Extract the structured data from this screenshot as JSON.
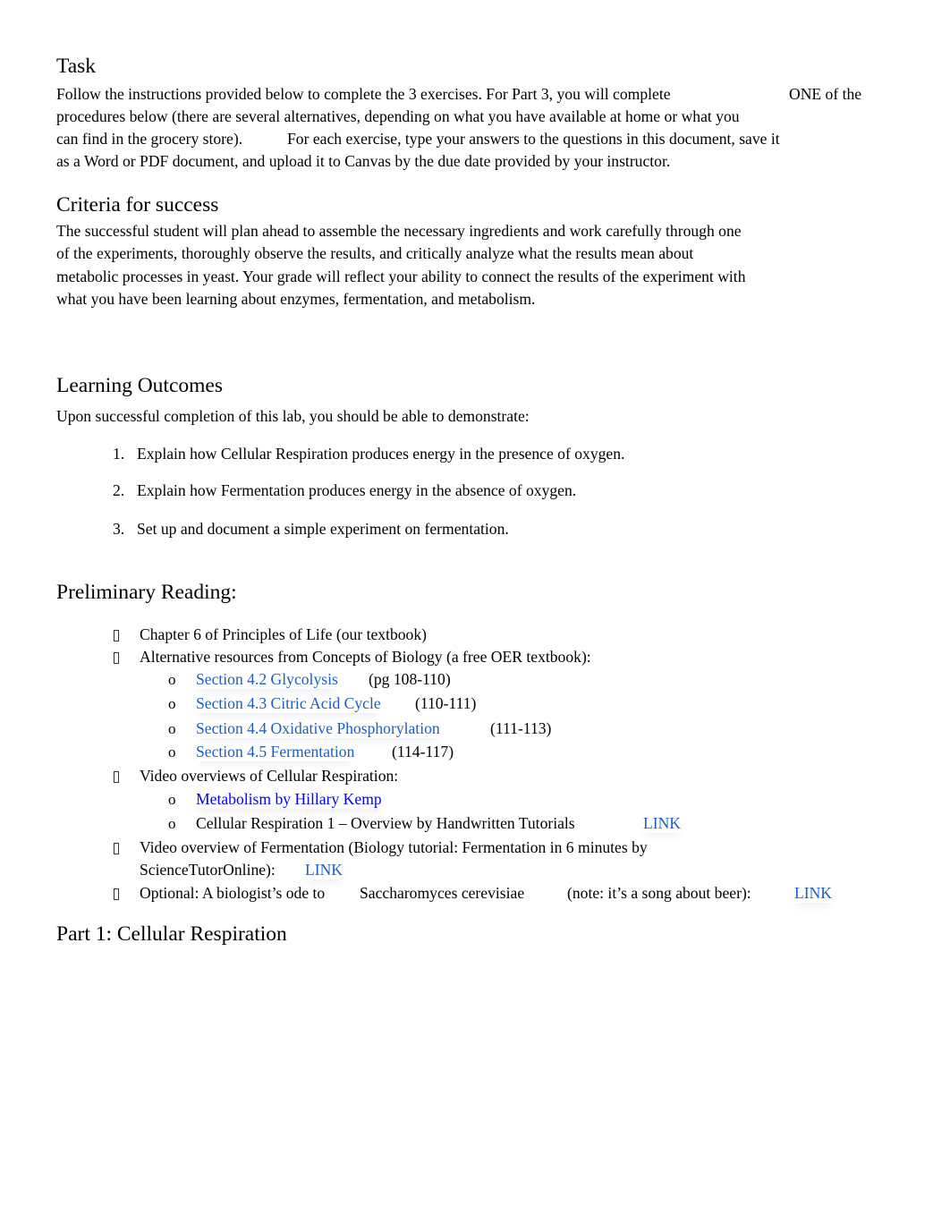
{
  "task": {
    "heading": "Task",
    "lines": [
      "Follow the instructions provided below to complete the 3 exercises. For Part 3, you will complete",
      "procedures below (there are several alternatives, depending on what you have available at home or what you",
      "can find in the grocery store).",
      "as a Word or PDF document, and upload it to Canvas by the due date provided by your instructor."
    ],
    "line1_tail": "ONE  of the",
    "line3_tail": "For each exercise, type your answers to the questions in this document, save it"
  },
  "criteria": {
    "heading": "Criteria for success",
    "lines": [
      "The successful student will plan ahead to assemble the necessary ingredients and work carefully through one",
      "of the experiments, thoroughly observe the results, and critically analyze what the results mean about",
      "metabolic processes in yeast. Your grade will reflect your ability to connect the results of the experiment with",
      "what you have been learning about enzymes, fermentation, and metabolism."
    ]
  },
  "outcomes": {
    "heading": "Learning Outcomes",
    "intro": "Upon successful completion of this lab, you should be able to demonstrate:",
    "items": [
      {
        "num": "1.",
        "text": "Explain how Cellular Respiration produces energy in the presence of oxygen."
      },
      {
        "num": "2.",
        "text": "Explain how Fermentation produces energy in the absence of oxygen."
      },
      {
        "num": "3.",
        "text": "Set up and document a simple experiment on fermentation."
      }
    ]
  },
  "reading": {
    "heading": "Preliminary Reading:",
    "bullet_icon": "missing-glyph-square",
    "sub_bullet": "o",
    "items": [
      {
        "text": "Chapter 6 of Principles of Life (our textbook)"
      },
      {
        "text": "Alternative resources from Concepts of Biology (a free OER textbook):",
        "sub": [
          {
            "link": "Section 4.2 Glycolysis",
            "suffix": "(pg 108-110)"
          },
          {
            "link": "Section 4.3 Citric Acid Cycle",
            "suffix": "(110-111)"
          },
          {
            "link": "Section 4.4 Oxidative Phosphorylation",
            "suffix": "(111-113)"
          },
          {
            "link": "Section 4.5 Fermentation",
            "suffix": "(114-117)"
          }
        ]
      },
      {
        "text": "Video overviews of Cellular Respiration:",
        "sub": [
          {
            "link": "Metabolism by Hillary Kemp"
          },
          {
            "text": "Cellular Respiration 1 – Overview by Handwritten Tutorials",
            "link": "LINK"
          }
        ]
      },
      {
        "text": "Video overview of Fermentation (Biology tutorial: Fermentation in 6 minutes by",
        "text2": "ScienceTutorOnline):",
        "link": "LINK"
      },
      {
        "text": "Optional: A biologist’s ode to",
        "italic": "Saccharomyces cerevisiae",
        "note": "(note: it’s a song about beer):",
        "link": "LINK"
      }
    ]
  },
  "part1": {
    "heading": "Part 1: Cellular Respiration"
  },
  "colors": {
    "link": "#1a5fc6",
    "link_pure": "#0000ff",
    "text": "#000000"
  }
}
